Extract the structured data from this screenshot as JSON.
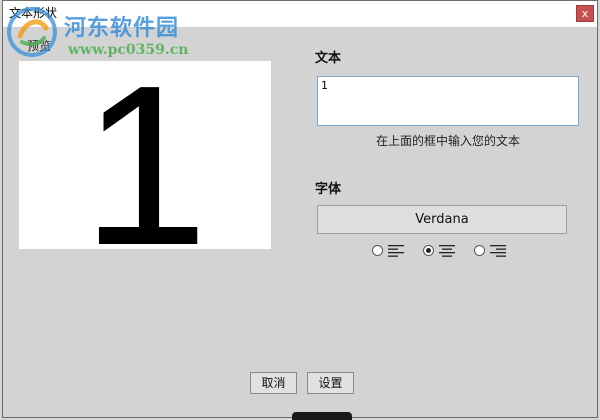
{
  "window": {
    "title": "文本形状",
    "close_label": "x"
  },
  "watermark": {
    "site_name": "河东软件园",
    "site_url": "www.pc0359.cn"
  },
  "preview": {
    "label": "预览",
    "rendered_text": "1"
  },
  "text_section": {
    "label": "文本",
    "input_value": "1",
    "hint": "在上面的框中输入您的文本"
  },
  "font_section": {
    "label": "字体",
    "font_name": "Verdana"
  },
  "alignment": {
    "options": [
      "left-align-icon",
      "center-align-icon",
      "right-align-icon"
    ],
    "selected": "center"
  },
  "buttons": {
    "cancel_label": "取消",
    "set_label": "设置"
  },
  "colors": {
    "dialog_bg": "#d3d3d3",
    "close_bg": "#c75050",
    "input_border": "#7aa7d6"
  }
}
